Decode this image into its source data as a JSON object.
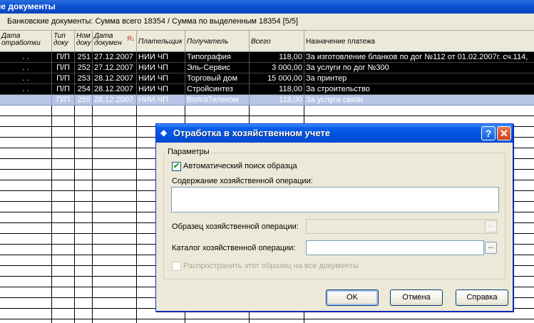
{
  "window": {
    "title": "ие документы"
  },
  "summary": "Банковские документы: Сумма всего 18354 / Сумма по выделенным 18354 [5/5]",
  "columns": [
    {
      "label": "Дата отработки"
    },
    {
      "label": "Тип доку"
    },
    {
      "label": "Ном доку"
    },
    {
      "label": "Дата докумен",
      "sort_indicator": "Я↓"
    },
    {
      "label": "Плательщик"
    },
    {
      "label": "Получатель"
    },
    {
      "label": "Всего"
    },
    {
      "label": "Назначение платежа"
    }
  ],
  "rows": [
    {
      "state": "selected",
      "date_proc": ". .",
      "type": "П/П",
      "num": "251",
      "date_doc": "27.12.2007",
      "payer": "НИИ ЧП",
      "recipient": "Типография",
      "total": "118,00",
      "purpose": "За изготовление бланков по дог №112 от 01.02.2007г. сч.114,"
    },
    {
      "state": "selected",
      "date_proc": ". .",
      "type": "П/П",
      "num": "252",
      "date_doc": "27.12.2007",
      "payer": "НИИ ЧП",
      "recipient": "Эль-Сервис",
      "total": "3 000,00",
      "purpose": "За услуги по дог №300"
    },
    {
      "state": "selected",
      "date_proc": ". .",
      "type": "П/П",
      "num": "253",
      "date_doc": "28.12.2007",
      "payer": "НИИ ЧП",
      "recipient": "Торговый дом",
      "total": "15 000,00",
      "purpose": "За принтер"
    },
    {
      "state": "selected",
      "date_proc": ". .",
      "type": "П/П",
      "num": "254",
      "date_doc": "28.12.2007",
      "payer": "НИИ ЧП",
      "recipient": "Стройсинтез",
      "total": "118,00",
      "purpose": "За строительство"
    },
    {
      "state": "current",
      "date_proc": ". .",
      "type": "П/П",
      "num": "255",
      "date_doc": "28.12.2007",
      "payer": "НИИ ЧП",
      "recipient": "ВолгаТелеком",
      "total": "118,00",
      "purpose": "За услуги связи"
    }
  ],
  "dialog": {
    "title": "Отработка в хозяйственном учете",
    "help_button": "?",
    "close_button": "✕",
    "group_label": "Параметры",
    "auto_search_label": "Автоматический поиск образца",
    "auto_search_checked": true,
    "content_label": "Содержание хозяйственной операции:",
    "content_value": "",
    "sample_label": "Образец хозяйственной операции:",
    "sample_value": "",
    "catalog_label": "Каталог хозяйственной операции:",
    "catalog_value": "",
    "browse_glyph": "...",
    "spread_label": "Распространить этот образец на все документы",
    "spread_checked": false,
    "ok": "OK",
    "cancel": "Отмена",
    "help": "Справка"
  }
}
